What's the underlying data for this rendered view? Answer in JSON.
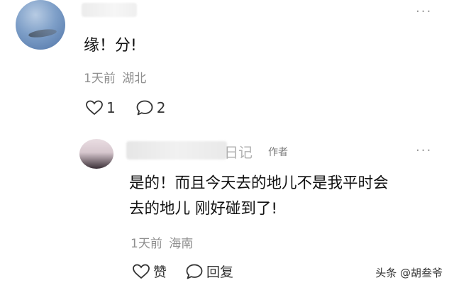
{
  "comment": {
    "text": "缘！分!",
    "time": "1天前",
    "location": "湖北",
    "like_count": "1",
    "reply_count": "2",
    "more": "···"
  },
  "reply": {
    "name_visible_tail": "日记",
    "author_tag": "作者",
    "text_line1": "是的！而且今天去的地儿不是我平时会",
    "text_line2": "去的地儿 刚好碰到了!",
    "time": "1天前",
    "location": "海南",
    "like_label": "赞",
    "reply_label": "回复",
    "more": "···"
  },
  "watermark": "头条 @胡叁爷"
}
